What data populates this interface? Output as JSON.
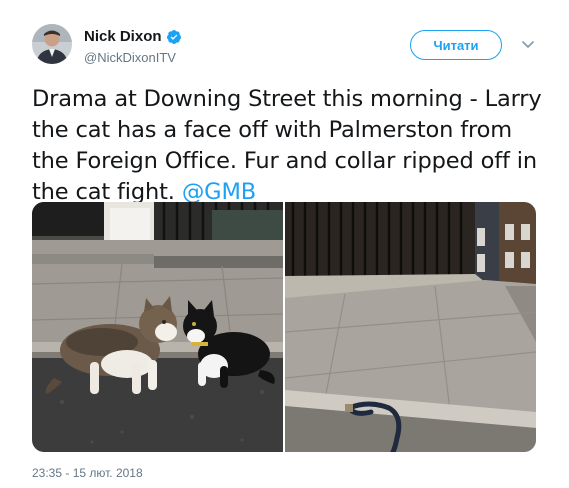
{
  "author": {
    "display_name": "Nick Dixon",
    "handle": "@NickDixonITV",
    "verified": true,
    "avatar_icon": "user-avatar"
  },
  "actions": {
    "follow_label": "Читати",
    "menu_icon": "chevron-down-icon"
  },
  "tweet": {
    "text": "Drama at Downing Street this morning - Larry the cat has a face off with Palmerston from the Foreign Office. Fur and collar ripped off in the cat fight. ",
    "mention": "@GMB",
    "timestamp": "23:35 - 15 лют. 2018"
  },
  "colors": {
    "accent": "#1da1f2",
    "text": "#14171a",
    "secondary": "#657786"
  }
}
